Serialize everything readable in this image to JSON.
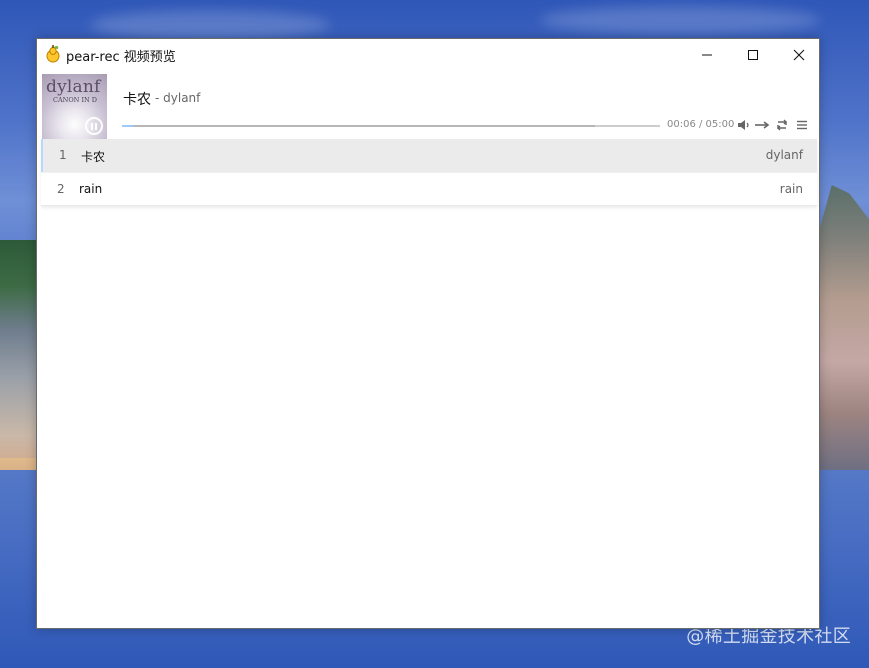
{
  "desktop": {
    "watermark": "@稀土掘金技术社区"
  },
  "window": {
    "title": "pear-rec 视频预览",
    "controls": {
      "minimize": "minimize-icon",
      "maximize": "maximize-icon",
      "close": "close-icon"
    }
  },
  "player": {
    "cover": {
      "title": "dylanf",
      "subtitle": "CANON IN D"
    },
    "current_song": {
      "title": "卡农",
      "artist": "- dylanf"
    },
    "time": "00:06 / 05:00",
    "progress": {
      "played_fraction": 0.02,
      "buffered_fraction": 0.88
    },
    "icons": {
      "volume": "volume-icon",
      "order": "order-icon",
      "loop": "loop-icon",
      "menu": "menu-icon"
    }
  },
  "playlist": [
    {
      "index": "1",
      "title": "卡农",
      "author": "dylanf"
    },
    {
      "index": "2",
      "title": "rain",
      "author": "rain"
    }
  ],
  "colors": {
    "window_bg": "#ffffff",
    "active_row_bg": "#ebebeb",
    "accent": "#9ec9ff"
  }
}
